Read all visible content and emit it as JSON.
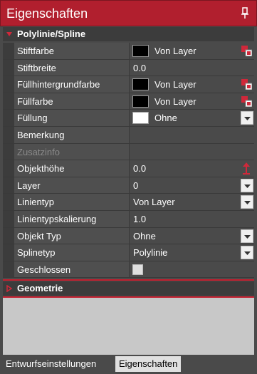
{
  "window": {
    "title": "Eigenschaften"
  },
  "sections": {
    "polyline": {
      "label": "Polylinie/Spline"
    },
    "geometry": {
      "label": "Geometrie"
    }
  },
  "properties": [
    {
      "name": "Stiftfarbe",
      "value": "Von Layer",
      "swatch": "#000000",
      "control": "color"
    },
    {
      "name": "Stiftbreite",
      "value": "0.0"
    },
    {
      "name": "Füllhintergrundfarbe",
      "value": "Von Layer",
      "swatch": "#000000",
      "control": "color"
    },
    {
      "name": "Füllfarbe",
      "value": "Von Layer",
      "swatch": "#000000",
      "control": "color"
    },
    {
      "name": "Füllung",
      "value": "Ohne",
      "swatch": "#ffffff",
      "control": "dropdown"
    },
    {
      "name": "Bemerkung",
      "value": ""
    },
    {
      "name": "Zusatzinfo",
      "value": "",
      "disabled": true
    },
    {
      "name": "Objekthöhe",
      "value": "0.0",
      "control": "height-arrow"
    },
    {
      "name": "Layer",
      "value": "0",
      "control": "dropdown"
    },
    {
      "name": "Linientyp",
      "value": "Von Layer",
      "control": "dropdown"
    },
    {
      "name": "Linientypskalierung",
      "value": "1.0"
    },
    {
      "name": "Objekt Typ",
      "value": "Ohne",
      "control": "dropdown"
    },
    {
      "name": "Splinetyp",
      "value": "Polylinie",
      "control": "dropdown"
    },
    {
      "name": "Geschlossen",
      "value": "",
      "control": "checkbox"
    }
  ],
  "tabs": [
    {
      "label": "Entwurfseinstellungen",
      "active": false
    },
    {
      "label": "Eigenschaften",
      "active": true
    }
  ],
  "colors": {
    "accent": "#b11f2e",
    "panel_bg": "#4a4a4a",
    "empty_bg": "#c8c8c8"
  },
  "icons": {
    "pin": "pin-icon",
    "collapse": "triangle-down-icon",
    "expand": "triangle-right-icon",
    "color_picker": "color-picker-icon",
    "dropdown": "chevron-down-icon",
    "height": "up-arrow-icon"
  }
}
